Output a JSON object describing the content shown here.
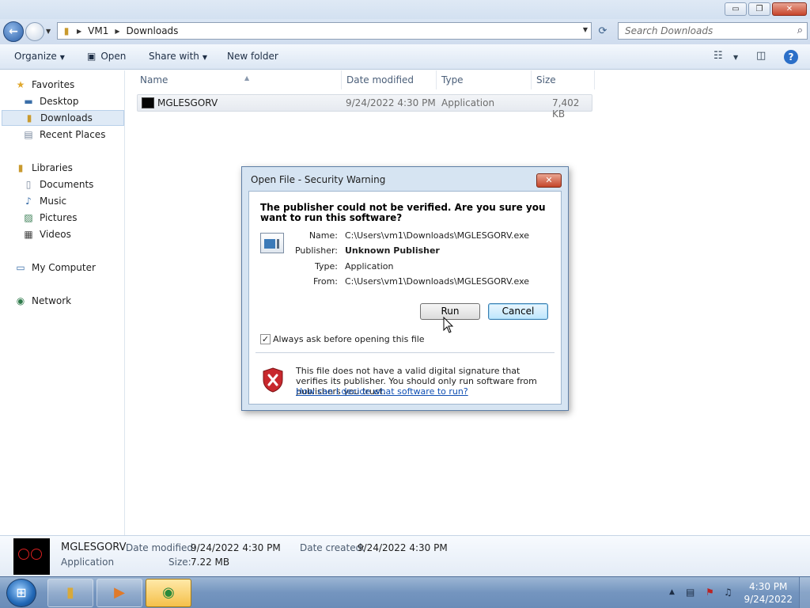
{
  "window": {
    "minimize": "▭",
    "maximize": "❐",
    "close": "✕"
  },
  "address": {
    "segments": [
      "VM1",
      "Downloads"
    ],
    "search_placeholder": "Search Downloads"
  },
  "toolbar": {
    "organize": "Organize",
    "open": "Open",
    "share_with": "Share with",
    "new_folder": "New folder"
  },
  "sidebar": {
    "favorites": "Favorites",
    "desktop": "Desktop",
    "downloads": "Downloads",
    "recent_places": "Recent Places",
    "libraries": "Libraries",
    "documents": "Documents",
    "music": "Music",
    "pictures": "Pictures",
    "videos": "Videos",
    "my_computer": "My Computer",
    "network": "Network"
  },
  "columns": {
    "name": "Name",
    "date_modified": "Date modified",
    "type": "Type",
    "size": "Size"
  },
  "files": [
    {
      "name": "MGLESGORV",
      "date_modified": "9/24/2022 4:30 PM",
      "type": "Application",
      "size": "7,402 KB"
    }
  ],
  "details": {
    "name": "MGLESGORV",
    "type": "Application",
    "date_modified_label": "Date modified:",
    "date_modified": "9/24/2022 4:30 PM",
    "date_created_label": "Date created:",
    "date_created": "9/24/2022 4:30 PM",
    "size_label": "Size:",
    "size": "7.22 MB"
  },
  "dialog": {
    "title": "Open File - Security Warning",
    "question": "The publisher could not be verified.  Are you sure you want to run this software?",
    "name_label": "Name:",
    "name_value": "C:\\Users\\vm1\\Downloads\\MGLESGORV.exe",
    "publisher_label": "Publisher:",
    "publisher_value": "Unknown Publisher",
    "type_label": "Type:",
    "type_value": "Application",
    "from_label": "From:",
    "from_value": "C:\\Users\\vm1\\Downloads\\MGLESGORV.exe",
    "run_button": "Run",
    "cancel_button": "Cancel",
    "always_ask_label": "Always ask before opening this file",
    "always_ask_checked": true,
    "warning_text": "This file does not have a valid digital signature that verifies its publisher.  You should only run software from publishers you trust.",
    "help_link": "How can I decide what software to run?"
  },
  "taskbar": {
    "time": "4:30 PM",
    "date": "9/24/2022"
  },
  "colors": {
    "accent": "#2b6fc8",
    "warning_red": "#c8282d",
    "link": "#0f4fb3"
  }
}
